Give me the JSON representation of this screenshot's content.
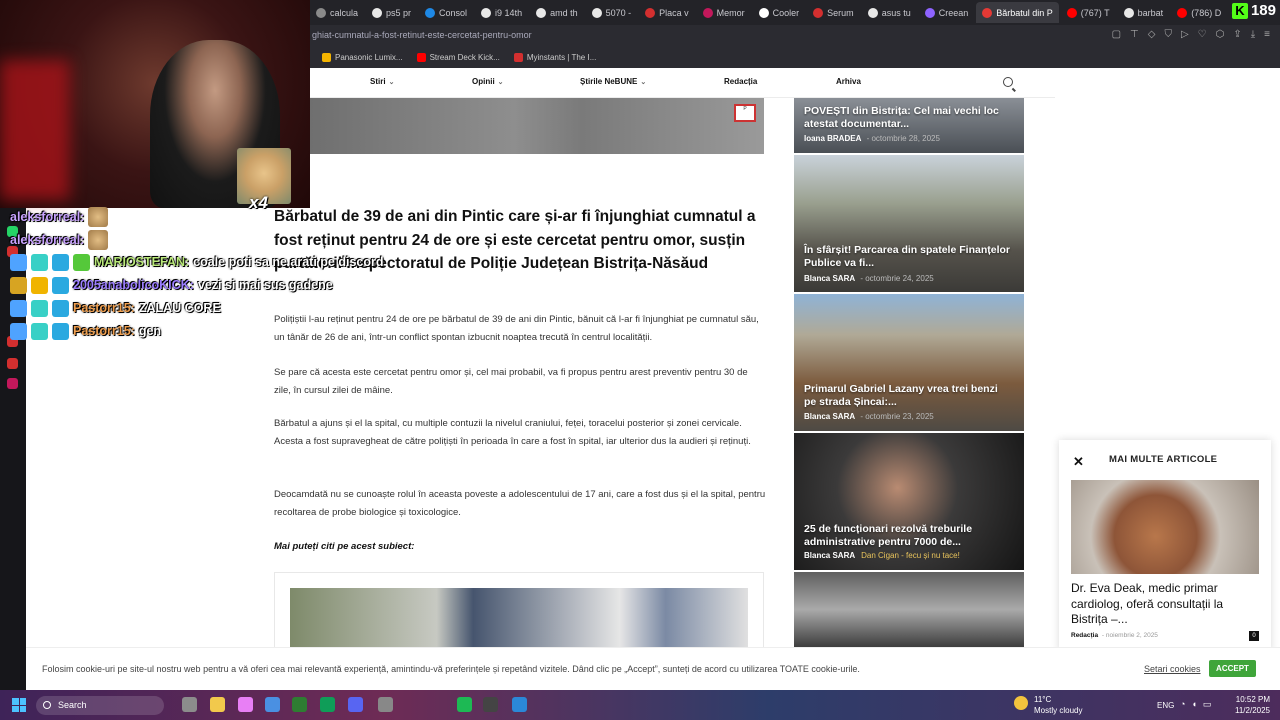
{
  "browser": {
    "tabs": [
      {
        "label": "calcula",
        "color": "#8a8a8a"
      },
      {
        "label": "ps5 pr",
        "color": "#e8e8e8"
      },
      {
        "label": "Consol",
        "color": "#1e88e5"
      },
      {
        "label": "i9 14th",
        "color": "#e8e8e8"
      },
      {
        "label": "amd th",
        "color": "#e8e8e8"
      },
      {
        "label": "5070 -",
        "color": "#e8e8e8"
      },
      {
        "label": "Placa v",
        "color": "#d32f2f"
      },
      {
        "label": "Memor",
        "color": "#c2185b"
      },
      {
        "label": "Cooler",
        "color": "#ffffff"
      },
      {
        "label": "Serum",
        "color": "#d32f2f"
      },
      {
        "label": "asus tu",
        "color": "#e8e8e8"
      },
      {
        "label": "Creean",
        "color": "#8e63ff"
      },
      {
        "label": "Bărbatul din P",
        "color": "#e53935",
        "active": true
      },
      {
        "label": "(767) T",
        "color": "#ff0000"
      },
      {
        "label": "barbat",
        "color": "#e8e8e8"
      },
      {
        "label": "(786) D",
        "color": "#ff0000"
      }
    ],
    "kick_count": "189",
    "url": "ghiat-cumnatul-a-fost-retinut-este-cercetat-pentru-omor",
    "bookmarks": [
      {
        "label": "Panasonic Lumix...",
        "color": "#f4b400"
      },
      {
        "label": "Stream Deck Kick...",
        "color": "#ff0000"
      },
      {
        "label": "Myinstants | The I...",
        "color": "#d32f2f"
      }
    ]
  },
  "nav": {
    "items": [
      {
        "label": "Stiri",
        "dropdown": true
      },
      {
        "label": "Opinii",
        "dropdown": true
      },
      {
        "label": "Știrile NeBUNE",
        "dropdown": true
      },
      {
        "label": "Redacția",
        "dropdown": false
      },
      {
        "label": "Arhiva",
        "dropdown": false
      }
    ]
  },
  "article": {
    "title": "Bărbatul de 39 de ani din Pintic care și-ar fi înjunghiat cumnatul a fost reținut pentru 24 de ore și este cercetat pentru omor, susțin purtătorii Inspectoratul de Poliție Județean Bistrița-Năsăud",
    "paragraphs": [
      "Polițiștii l-au reținut pentru 24 de ore pe bărbatul de 39 de ani din Pintic, bănuit că l-ar fi înjunghiat pe cumnatul său, un tânăr de 26 de ani, într-un conflict spontan izbucnit noaptea trecută în centrul localității.",
      "Se pare că acesta este cercetat pentru omor și, cel mai probabil, va fi propus pentru arest preventiv pentru 30 de zile, în cursul zilei de mâine.",
      "Bărbatul a ajuns și el la spital, cu multiple contuzii la nivelul craniului, feței, toracelui posterior și zonei cervicale. Acesta a fost supravegheat de către polițiști în perioada în care a fost în spital, iar ulterior dus la audieri și reținuți.",
      "Deocamdată nu se cunoaște rolul în aceasta poveste a adolescentului de 17 ani, care a fost dus și el la spital, pentru recoltarea de probe biologice și toxicologice."
    ],
    "more_label": "Mai puteți citi pe acest subiect:"
  },
  "sidebar": {
    "cards": [
      {
        "title": "POVEȘTI din Bistrița: Cel mai vechi loc atestat documentar...",
        "author": "Ioana BRADEA",
        "date": "octombrie 28, 2025"
      },
      {
        "title": "În sfârșit! Parcarea din spatele Finanțelor Publice va fi...",
        "author": "Blanca SARA",
        "date": "octombrie 24, 2025"
      },
      {
        "title": "Primarul Gabriel Lazany vrea trei benzi pe strada Șincai:...",
        "author": "Blanca SARA",
        "date": "octombrie 23, 2025"
      },
      {
        "title": "25 de funcționari rezolvă treburile administrative pentru 7000 de...",
        "author": "Blanca SARA",
        "date": "",
        "overlay": "Dan Cigan - fecu și nu tace!"
      },
      {
        "title": "",
        "author": "",
        "date": ""
      }
    ]
  },
  "widget": {
    "heading": "MAI MULTE ARTICOLE",
    "title": "Dr. Eva Deak, medic primar cardiolog, oferă consultații la Bistrița –...",
    "author": "Redacția",
    "date": "noiembrie 2, 2025",
    "comments": "0"
  },
  "cookie": {
    "text": "Folosim cookie-uri pe site-ul nostru web pentru a vă oferi cea mai relevantă experiență, amintindu-vă preferințele și repetând vizitele. Dând clic pe „Accept”, sunteți de acord cu utilizarea TOATE cookie-urile.",
    "settings": "Setari cookies",
    "accept": "ACCEPT"
  },
  "stream": {
    "emote_multiplier": "x4",
    "chat": [
      {
        "user": "aleksforreal:",
        "msg": "",
        "badges": [],
        "emote": true
      },
      {
        "user": "aleksforreal:",
        "msg": "",
        "badges": [],
        "emote": true
      },
      {
        "user": "MARIOSTEFAN:",
        "msg": "coale poti sa ne arati pe discord",
        "badges": [
          "#4fa3ff",
          "#38d0c6",
          "#2aa9e0",
          "#55c83a"
        ],
        "user_color": "#b9e87a"
      },
      {
        "user": "2005anabolicoKICK:",
        "msg": "vezi si mai sus gadene",
        "badges": [
          "#d7a422",
          "#f0b400",
          "#2aa9e0"
        ],
        "user_color": "#9b7dff"
      },
      {
        "user": "Pastorr15:",
        "msg": "ZALAU CORE",
        "badges": [
          "#4fa3ff",
          "#38d0c6",
          "#2aa9e0"
        ],
        "user_color": "#f0a050"
      },
      {
        "user": "Pastorr15:",
        "msg": "gen",
        "badges": [
          "#4fa3ff",
          "#38d0c6",
          "#2aa9e0"
        ],
        "user_color": "#f0a050"
      }
    ]
  },
  "taskbar": {
    "search": "Search",
    "apps": [
      "#8c8c8c",
      "#f2c94c",
      "#e87ff5",
      "#4a90e2",
      "#2e7d32",
      "#0f9d58",
      "#5865f2",
      "#888888",
      "#1db954",
      "#444444",
      "#2b88d8"
    ],
    "weather_temp": "11°C",
    "weather_desc": "Mostly cloudy",
    "lang": "ENG",
    "time": "10:52 PM",
    "date": "11/2/2025"
  }
}
